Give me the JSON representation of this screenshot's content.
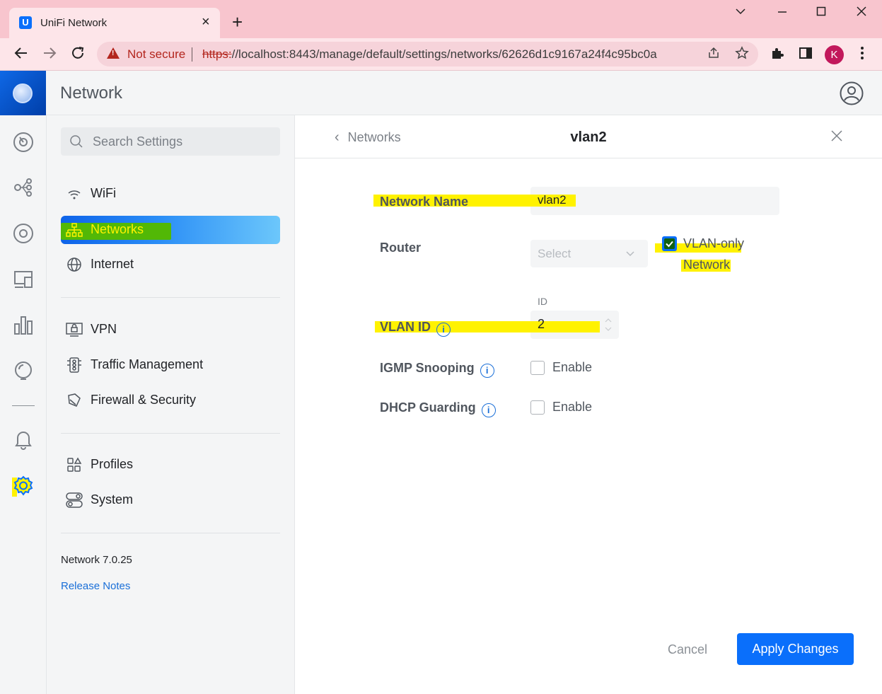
{
  "browser": {
    "tab_title": "UniFi Network",
    "tab_close": "×",
    "new_tab": "+",
    "security_label": "Not secure",
    "url_scheme": "https:",
    "url_rest": "//localhost:8443/manage/default/settings/networks/62626d1c9167a24f4c95bc0a",
    "profile_initial": "K",
    "window_controls": [
      "minimize",
      "maximize",
      "close"
    ]
  },
  "app": {
    "title": "Network"
  },
  "rail": {
    "icons": [
      "dashboard-icon",
      "topology-icon",
      "devices-icon",
      "clients-icon",
      "statistics-icon",
      "insights-icon",
      "notifications-icon",
      "settings-icon"
    ],
    "active": "settings-icon"
  },
  "settings_nav": {
    "search_placeholder": "Search Settings",
    "items": [
      {
        "label": "WiFi",
        "icon": "wifi-icon"
      },
      {
        "label": "Networks",
        "icon": "network-icon",
        "active": true
      },
      {
        "label": "Internet",
        "icon": "globe-icon"
      },
      {
        "label": "VPN",
        "icon": "vpn-icon"
      },
      {
        "label": "Traffic Management",
        "icon": "traffic-icon"
      },
      {
        "label": "Firewall & Security",
        "icon": "shield-icon"
      },
      {
        "label": "Profiles",
        "icon": "profiles-icon"
      },
      {
        "label": "System",
        "icon": "system-icon"
      }
    ],
    "version": "Network 7.0.25",
    "release_notes": "Release Notes"
  },
  "panel": {
    "back_label": "Networks",
    "title": "vlan2",
    "fields": {
      "network_name": {
        "label": "Network Name",
        "value": "vlan2"
      },
      "router": {
        "label": "Router",
        "placeholder": "Select",
        "vlan_only_line1": "VLAN-only",
        "vlan_only_line2": "Network",
        "vlan_only_checked": true
      },
      "vlan_id": {
        "label": "VLAN ID",
        "caption": "ID",
        "value": "2"
      },
      "igmp": {
        "label": "IGMP Snooping",
        "option": "Enable",
        "checked": false
      },
      "dhcp_guarding": {
        "label": "DHCP Guarding",
        "option": "Enable",
        "checked": false
      }
    },
    "info_glyph": "i",
    "cancel_label": "Cancel",
    "apply_label": "Apply Changes"
  },
  "colors": {
    "accent": "#0a6ffb",
    "highlight": "#fff200",
    "active_highlight": "#52b806",
    "chrome": "#f8c5ce"
  }
}
